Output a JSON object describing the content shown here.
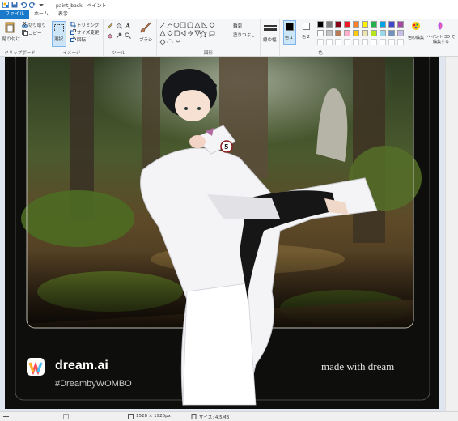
{
  "titlebar": {
    "title": "paint_back - ペイント"
  },
  "tabs": [
    {
      "label": "ファイル"
    },
    {
      "label": "ホーム"
    },
    {
      "label": "表示"
    }
  ],
  "ribbon": {
    "clipboard": {
      "paste": "貼り付け",
      "cut": "切り取り",
      "copy": "コピー",
      "label": "クリップボード"
    },
    "image": {
      "select": "選択",
      "crop": "トリミング",
      "resize": "サイズ変更",
      "rotate": "回転",
      "label": "イメージ"
    },
    "tools": {
      "label": "ツール"
    },
    "brushes": {
      "label": "ブラシ"
    },
    "shapes": {
      "outline": "輪郭",
      "fill": "塗りつぶし",
      "label": "図形"
    },
    "size": {
      "label": "線の幅"
    },
    "colors": {
      "color1": "色 1",
      "color2": "色 2",
      "edit": "色の編集",
      "label": "色",
      "paint3d": "ペイント 3D で編集する"
    },
    "palette": [
      "#000000",
      "#7f7f7f",
      "#880015",
      "#ed1c24",
      "#ff7f27",
      "#fff200",
      "#22b14c",
      "#00a2e8",
      "#3f48cc",
      "#a349a4",
      "#ffffff",
      "#c3c3c3",
      "#b97a57",
      "#ffaec9",
      "#ffc90e",
      "#efe4b0",
      "#b5e61d",
      "#99d9ea",
      "#7092be",
      "#c8bfe7"
    ]
  },
  "canvas": {
    "watermark_brand": "dream.ai",
    "watermark_tag": "#DreambyWOMBO",
    "watermark_made": "made with dream"
  },
  "status": {
    "dimensions": "1528 × 1920px",
    "filesize": "サイズ: 4.5MB"
  }
}
